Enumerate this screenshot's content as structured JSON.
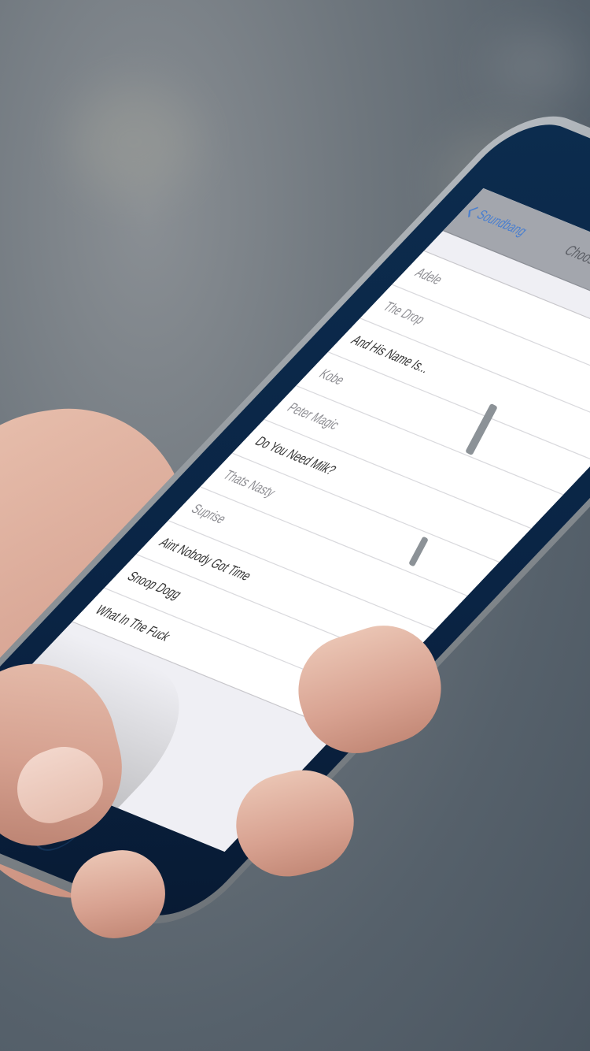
{
  "nav": {
    "back_label": "Soundbang",
    "title": "Choose Sound"
  },
  "sounds": [
    {
      "label": "Adele"
    },
    {
      "label": "The Drop"
    },
    {
      "label": "And His Name Is..."
    },
    {
      "label": "Kobe"
    },
    {
      "label": "Peter Magic"
    },
    {
      "label": "Do You Need Milk?"
    },
    {
      "label": "Thats Nasty"
    },
    {
      "label": "Suprise"
    },
    {
      "label": "Aint Nobody Got Time"
    },
    {
      "label": "Snoop Dogg"
    },
    {
      "label": "What In The Fuck"
    }
  ],
  "selected_index": 10,
  "colors": {
    "accent": "#3d74c8",
    "navbar": "#a3a6ad",
    "screen_bg": "#efeff4",
    "phone_glass": "#0c2c4e"
  },
  "icons": {
    "back": "chevron-left-icon",
    "selected": "checkmark-icon"
  }
}
